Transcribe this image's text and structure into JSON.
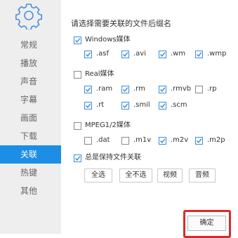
{
  "sidebar": {
    "items": [
      {
        "label": "常规",
        "active": false
      },
      {
        "label": "播放",
        "active": false
      },
      {
        "label": "声音",
        "active": false
      },
      {
        "label": "字幕",
        "active": false
      },
      {
        "label": "画面",
        "active": false
      },
      {
        "label": "下载",
        "active": false
      },
      {
        "label": "关联",
        "active": true
      },
      {
        "label": "热键",
        "active": false
      },
      {
        "label": "其他",
        "active": false
      }
    ]
  },
  "main": {
    "heading": "请选择需要关联的文件后缀名",
    "groups": [
      {
        "label": "Windows媒体",
        "checked": true,
        "items": [
          {
            "label": ".asf",
            "checked": true
          },
          {
            "label": ".avi",
            "checked": true
          },
          {
            "label": ".wm",
            "checked": true
          },
          {
            "label": ".wmp",
            "checked": true
          }
        ]
      },
      {
        "label": "Real媒体",
        "checked": false,
        "items": [
          {
            "label": ".ram",
            "checked": true
          },
          {
            "label": ".rm",
            "checked": true
          },
          {
            "label": ".rmvb",
            "checked": true
          },
          {
            "label": ".rp",
            "checked": false
          },
          {
            "label": ".rt",
            "checked": true
          },
          {
            "label": ".smil",
            "checked": true
          },
          {
            "label": ".scm",
            "checked": true
          }
        ]
      },
      {
        "label": "MPEG1/2媒体",
        "checked": false,
        "items": [
          {
            "label": ".dat",
            "checked": false
          },
          {
            "label": ".m1v",
            "checked": false
          },
          {
            "label": ".m2v",
            "checked": true
          },
          {
            "label": ".m2p",
            "checked": true
          }
        ]
      }
    ],
    "always_keep": {
      "label": "总是保持文件关联",
      "checked": true
    },
    "buttons": [
      "全选",
      "全不选",
      "视频",
      "音频"
    ],
    "ok_label": "确定"
  },
  "colors": {
    "accent": "#1d8ee6",
    "highlight": "#d92b2b",
    "check": "#3a8fd8"
  }
}
